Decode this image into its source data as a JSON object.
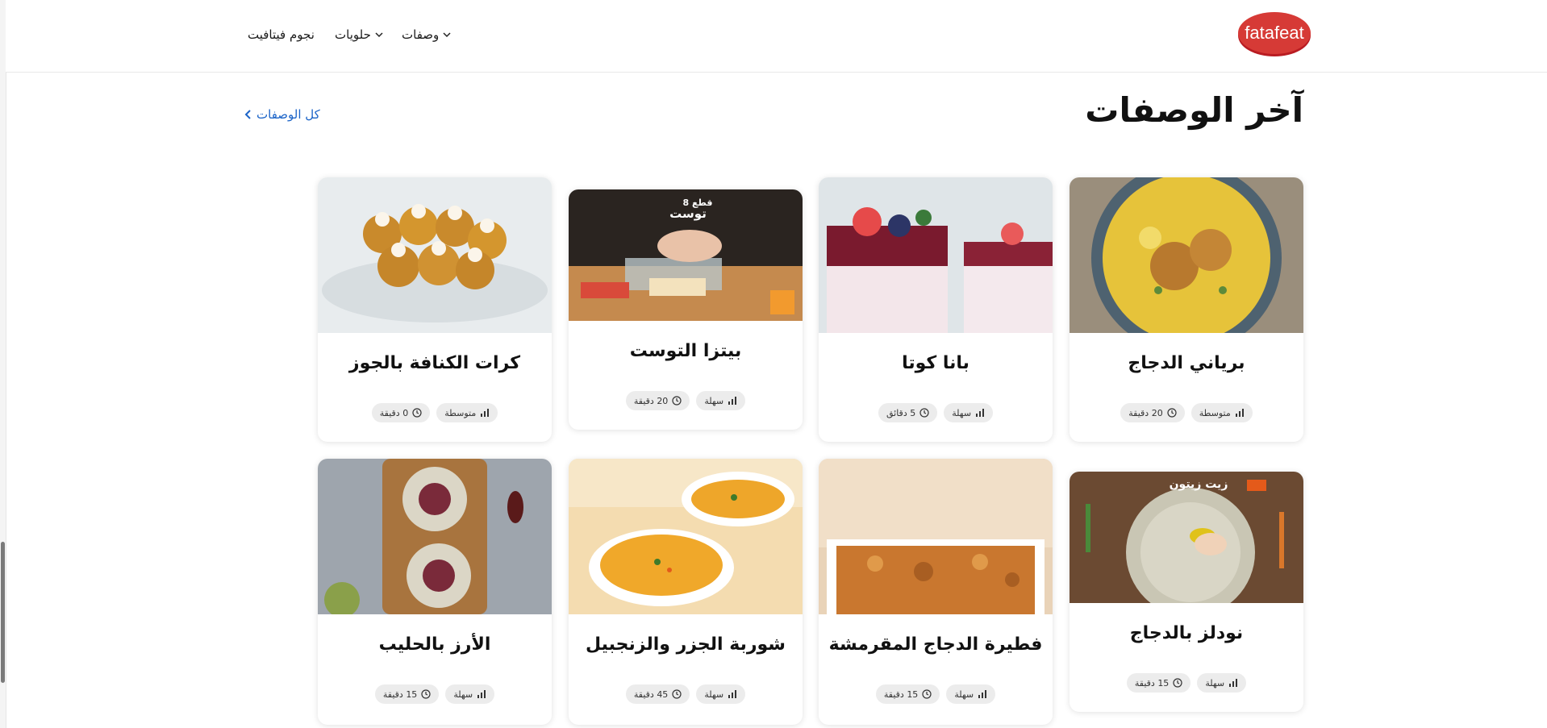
{
  "header": {
    "logo_text": "fatafeat",
    "brand_color": "#d2232a",
    "nav": [
      {
        "label": "وصفات",
        "has_dropdown": true
      },
      {
        "label": "حلويات",
        "has_dropdown": true
      },
      {
        "label": "نجوم فيتافيت",
        "has_dropdown": false
      }
    ]
  },
  "section": {
    "title": "آخر الوصفات",
    "all_link": "كل الوصفات",
    "link_color": "#1c64c8"
  },
  "cards": [
    {
      "title": "برياني الدجاج",
      "difficulty": "متوسطة",
      "time": "20 دقيقة"
    },
    {
      "title": "بانا كوتا",
      "difficulty": "سهلة",
      "time": "5 دقائق"
    },
    {
      "title": "بيتزا التوست",
      "difficulty": "سهلة",
      "time": "20 دقيقة",
      "overlay_text": [
        "8 قطع",
        "توست"
      ]
    },
    {
      "title": "كرات الكنافة بالجوز",
      "difficulty": "متوسطة",
      "time": "0 دقيقة"
    },
    {
      "title": "نودلز بالدجاج",
      "difficulty": "سهلة",
      "time": "15 دقيقة",
      "overlay_text": [
        "زيت زيتون"
      ]
    },
    {
      "title": "فطيرة الدجاج المقرمشة",
      "difficulty": "سهلة",
      "time": "15 دقيقة"
    },
    {
      "title": "شوربة الجزر والزنجبيل",
      "difficulty": "سهلة",
      "time": "45 دقيقة"
    },
    {
      "title": "الأرز بالحليب",
      "difficulty": "سهلة",
      "time": "15 دقيقة"
    }
  ],
  "icons": {
    "difficulty": "bar-chart-icon",
    "time": "clock-icon",
    "dropdown": "chevron-down-icon",
    "link": "chevron-left-icon"
  }
}
